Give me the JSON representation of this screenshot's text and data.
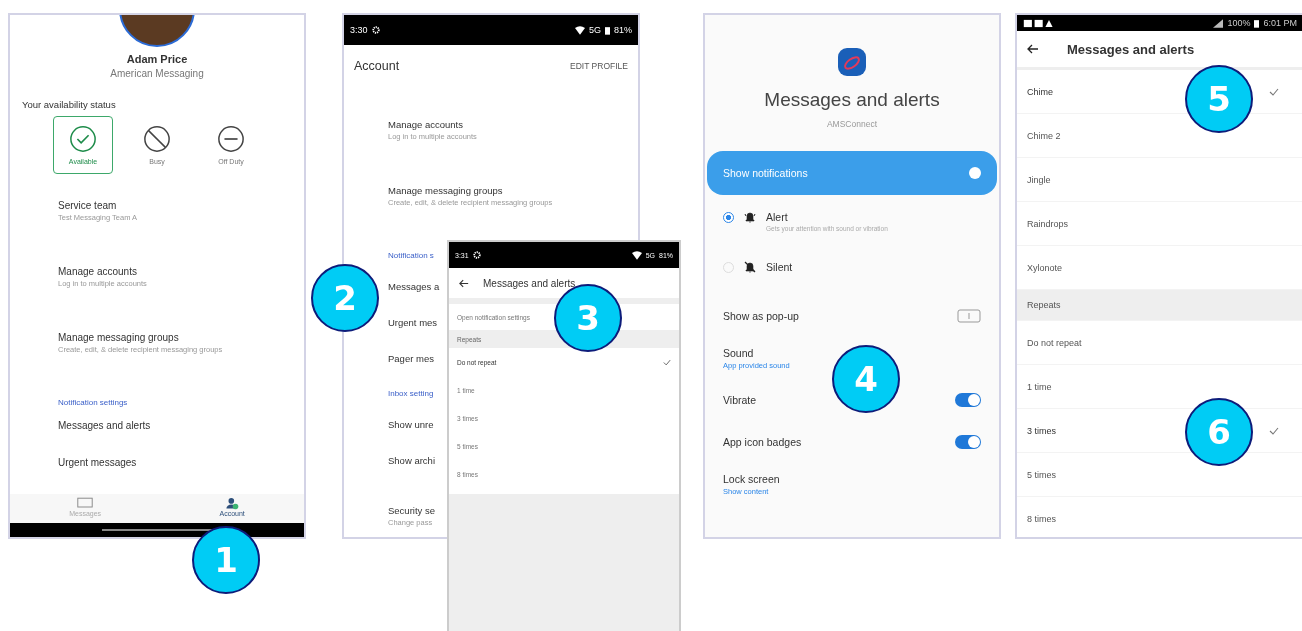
{
  "profile_screen": {
    "name": "Adam Price",
    "organization": "American Messaging",
    "availability_label": "Your availability status",
    "statuses": [
      {
        "kind": "available",
        "label": "Available",
        "selected": true
      },
      {
        "kind": "busy",
        "label": "Busy",
        "selected": false
      },
      {
        "kind": "off",
        "label": "Off Duty",
        "selected": false
      }
    ],
    "items": [
      {
        "kind": "item",
        "title": "Service team",
        "subtitle": "Test Messaging Team A"
      },
      {
        "kind": "item",
        "title": "Manage accounts",
        "subtitle": "Log in to multiple accounts"
      },
      {
        "kind": "item",
        "title": "Manage messaging groups",
        "subtitle": "Create, edit, & delete recipient messaging groups"
      },
      {
        "kind": "header",
        "title": "Notification settings"
      },
      {
        "kind": "item",
        "title": "Messages and alerts"
      },
      {
        "kind": "item",
        "title": "Urgent messages"
      }
    ],
    "nav": [
      {
        "kind": "messages",
        "label": "Messages",
        "selected": false
      },
      {
        "kind": "account",
        "label": "Account",
        "selected": true
      }
    ]
  },
  "account_screen": {
    "status_bar": {
      "time": "3:30",
      "network": "5G",
      "battery": "81%"
    },
    "title": "Account",
    "action": "EDIT PROFILE",
    "items": [
      {
        "kind": "item",
        "title": "Manage accounts",
        "subtitle": "Log in to multiple accounts"
      },
      {
        "kind": "item",
        "title": "Manage messaging groups",
        "subtitle": "Create, edit, & delete recipient messaging groups"
      },
      {
        "kind": "header",
        "title": "Notification s"
      },
      {
        "kind": "item",
        "title": "Messages a"
      },
      {
        "kind": "item",
        "title": "Urgent mes"
      },
      {
        "kind": "item",
        "title": "Pager mes"
      },
      {
        "kind": "header",
        "title": "Inbox setting"
      },
      {
        "kind": "item",
        "title": "Show unre"
      },
      {
        "kind": "item",
        "title": "Show archi"
      },
      {
        "kind": "item",
        "title": "Security se",
        "subtitle": "Change pass"
      }
    ]
  },
  "repeats_screen": {
    "status_bar": {
      "time": "3:31",
      "network": "5G",
      "battery": "81%"
    },
    "title": "Messages and alerts",
    "items": [
      {
        "kind": "link",
        "label": "Open notification settings"
      },
      {
        "kind": "header",
        "label": "Repeats"
      },
      {
        "kind": "option",
        "label": "Do not repeat",
        "selected": true
      },
      {
        "kind": "option",
        "label": "1 time",
        "selected": false
      },
      {
        "kind": "option",
        "label": "3 times",
        "selected": false
      },
      {
        "kind": "option",
        "label": "5 times",
        "selected": false
      },
      {
        "kind": "option",
        "label": "8 times",
        "selected": false
      }
    ]
  },
  "notification_screen": {
    "title": "Messages and alerts",
    "app_name": "AMSConnect",
    "show_notifications": {
      "label": "Show notifications",
      "on": true
    },
    "modes": [
      {
        "kind": "alert",
        "label": "Alert",
        "description": "Gets your attention with sound or vibration",
        "selected": true
      },
      {
        "kind": "silent",
        "label": "Silent",
        "selected": false
      }
    ],
    "settings": [
      {
        "kind": "popup",
        "label": "Show as pop-up"
      },
      {
        "kind": "value",
        "label": "Sound",
        "value": "App provided sound"
      },
      {
        "kind": "switch",
        "label": "Vibrate",
        "on": true
      },
      {
        "kind": "switch",
        "label": "App icon badges",
        "on": true
      },
      {
        "kind": "value",
        "label": "Lock screen",
        "value": "Show content"
      }
    ]
  },
  "sound_screen": {
    "status_bar": {
      "battery": "100%",
      "time": "6:01 PM"
    },
    "title": "Messages and alerts",
    "items": [
      {
        "kind": "option",
        "label": "Chime",
        "selected": true
      },
      {
        "kind": "option",
        "label": "Chime 2",
        "selected": false
      },
      {
        "kind": "option",
        "label": "Jingle",
        "selected": false
      },
      {
        "kind": "option",
        "label": "Raindrops",
        "selected": false
      },
      {
        "kind": "option",
        "label": "Xylonote",
        "selected": false
      },
      {
        "kind": "header",
        "label": "Repeats"
      },
      {
        "kind": "option",
        "label": "Do not repeat",
        "selected": false
      },
      {
        "kind": "option",
        "label": "1 time",
        "selected": false
      },
      {
        "kind": "option",
        "label": "3 times",
        "selected": true
      },
      {
        "kind": "option",
        "label": "5 times",
        "selected": false
      },
      {
        "kind": "option",
        "label": "8 times",
        "selected": false
      }
    ]
  },
  "step_badges": [
    "1",
    "2",
    "3",
    "4",
    "5",
    "6"
  ]
}
